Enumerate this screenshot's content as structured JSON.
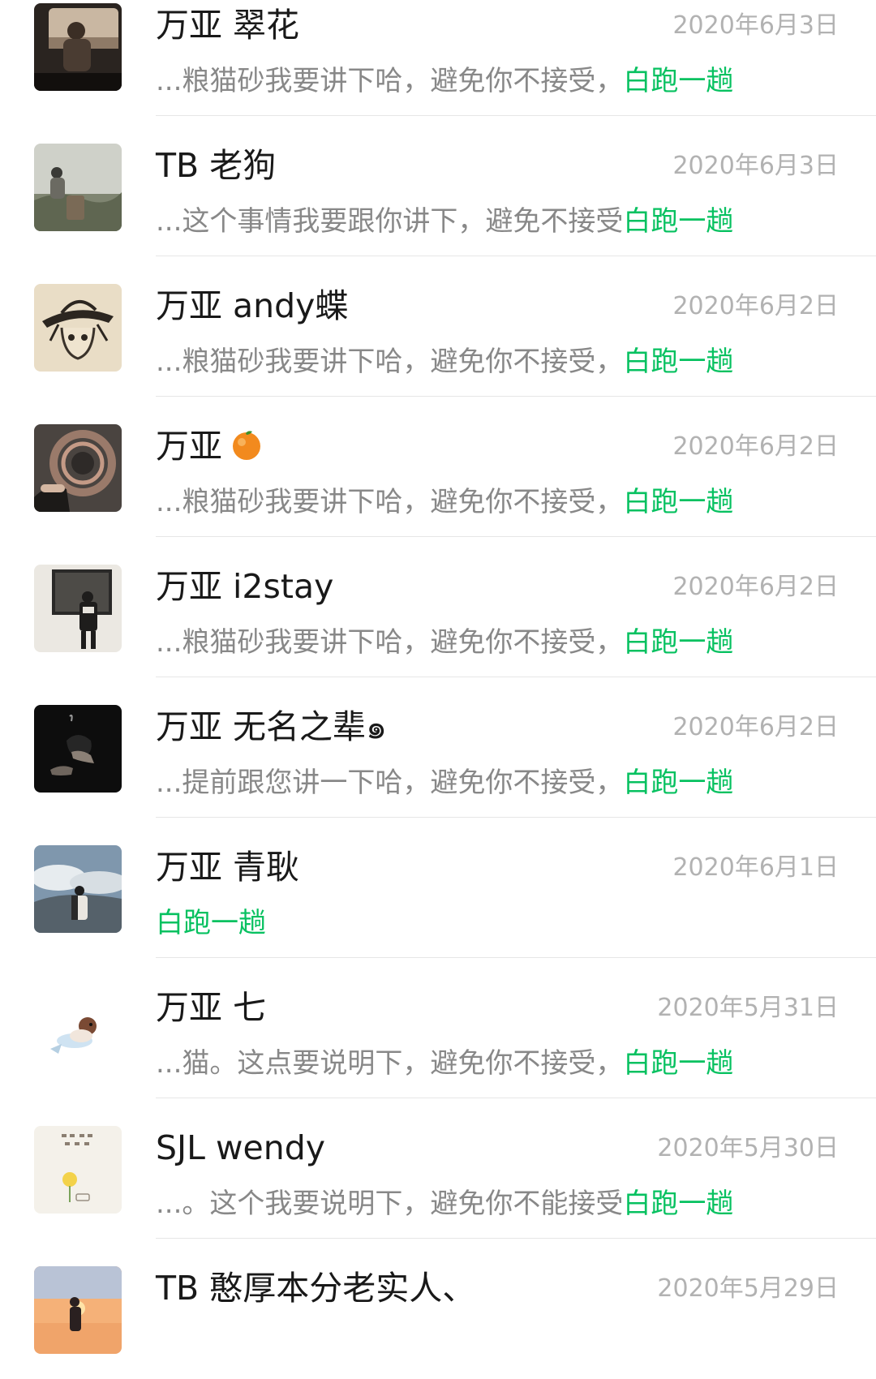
{
  "colors": {
    "name": "#191919",
    "date": "#b2b2b2",
    "preview": "#888888",
    "highlight": "#07c160",
    "divider": "#e6e6e6"
  },
  "chats": [
    {
      "name": "万亚 翠花",
      "date": "2020年6月3日",
      "preview": "...粮猫砂我要讲下哈，避免你不接受，",
      "tag": "白跑一趟",
      "avatar": "avatar-car-window"
    },
    {
      "name": "TB 老狗",
      "date": "2020年6月3日",
      "preview": "...这个事情我要跟你讲下，避免不接受",
      "tag": "白跑一趟",
      "avatar": "avatar-foggy-hill"
    },
    {
      "name": "万亚 andy蝶",
      "date": "2020年6月2日",
      "preview": "...粮猫砂我要讲下哈，避免你不接受，",
      "tag": "白跑一趟",
      "avatar": "avatar-straw-hat-sketch"
    },
    {
      "name": "万亚",
      "name_emoji": "orange-emoji",
      "date": "2020年6月2日",
      "preview": "...粮猫砂我要讲下哈，避免你不接受，",
      "tag": "白跑一趟",
      "avatar": "avatar-tunnel-ring"
    },
    {
      "name": "万亚 i2stay",
      "date": "2020年6月2日",
      "preview": "...粮猫砂我要讲下哈，避免你不接受，",
      "tag": "白跑一趟",
      "avatar": "avatar-person-back"
    },
    {
      "name": "万亚 无名之辈๑",
      "date": "2020年6月2日",
      "preview": "...提前跟您讲一下哈，避免你不接受，",
      "tag": "白跑一趟",
      "avatar": "avatar-dark-hands"
    },
    {
      "name": "万亚 青耿",
      "date": "2020年6月1日",
      "preview": "",
      "tag": "白跑一趟",
      "avatar": "avatar-cloud-mountain"
    },
    {
      "name": "万亚 七",
      "date": "2020年5月31日",
      "preview": "...猫。这点要说明下，避免你不接受，",
      "tag": "白跑一趟",
      "avatar": "avatar-flying-dog"
    },
    {
      "name": "SJL wendy",
      "date": "2020年5月30日",
      "preview": "...。这个我要说明下，避免你不能接受",
      "tag": "白跑一趟",
      "avatar": "avatar-flower-text"
    },
    {
      "name": "TB 憨厚本分老实人、",
      "date": "2020年5月29日",
      "preview": "",
      "tag": "",
      "avatar": "avatar-sunset"
    }
  ]
}
